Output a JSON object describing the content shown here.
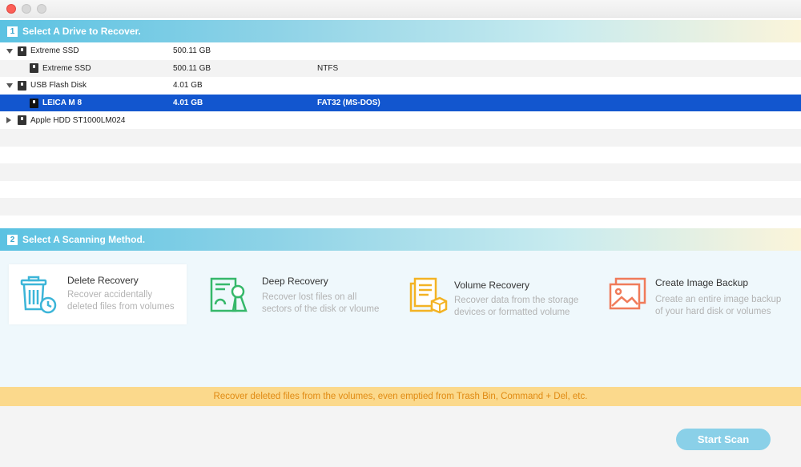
{
  "window": {
    "controls": [
      "close",
      "minimize",
      "zoom"
    ]
  },
  "section1": {
    "step": "1",
    "title": "Select A Drive to Recover."
  },
  "drives": [
    {
      "name": "Extreme SSD",
      "size": "500.11 GB",
      "fs": "",
      "level": 0,
      "expand": "down",
      "selected": false
    },
    {
      "name": "Extreme SSD",
      "size": "500.11 GB",
      "fs": "NTFS",
      "level": 1,
      "expand": "",
      "selected": false
    },
    {
      "name": "USB Flash Disk",
      "size": "4.01 GB",
      "fs": "",
      "level": 0,
      "expand": "down",
      "selected": false
    },
    {
      "name": "LEICA M 8",
      "size": "4.01 GB",
      "fs": "FAT32 (MS-DOS)",
      "level": 1,
      "expand": "",
      "selected": true
    },
    {
      "name": "Apple HDD ST1000LM024",
      "size": "",
      "fs": "",
      "level": 0,
      "expand": "right",
      "selected": false
    }
  ],
  "section2": {
    "step": "2",
    "title": "Select A Scanning Method."
  },
  "methods": [
    {
      "title": "Delete Recovery",
      "desc1": "Recover accidentally",
      "desc2": "deleted files from volumes",
      "icon": "trash-clock-icon",
      "active": true
    },
    {
      "title": "Deep Recovery",
      "desc1": "Recover lost files on all",
      "desc2": "sectors of the disk or vloume",
      "icon": "document-search-icon",
      "active": false
    },
    {
      "title": "Volume Recovery",
      "desc1": "Recover data from the storage",
      "desc2": "devices or formatted volume",
      "icon": "box-documents-icon",
      "active": false
    },
    {
      "title": "Create Image Backup",
      "desc1": "Create an entire image backup",
      "desc2": "of your hard disk or volumes",
      "icon": "image-backup-icon",
      "active": false
    }
  ],
  "hint": "Recover deleted files from the volumes, even emptied from Trash Bin, Command + Del, etc.",
  "start_button": "Start Scan",
  "colors": {
    "accent": "#5bc2e2",
    "selected_row": "#1256cf",
    "hint_bg": "#fbd98c",
    "hint_text": "#e08a12",
    "delete_icon": "#3cb5d8",
    "deep_icon": "#36b86a",
    "volume_icon": "#f3b324",
    "image_icon": "#f07b5a"
  }
}
